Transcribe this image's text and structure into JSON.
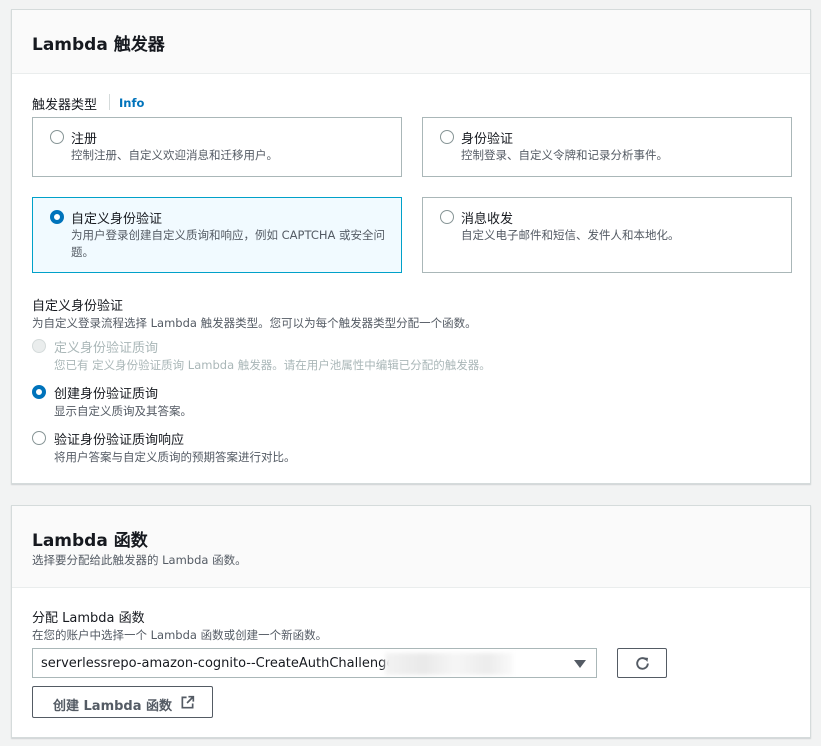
{
  "trigger_panel": {
    "title": "Lambda 触发器",
    "trigger_type_label": "触发器类型",
    "info_link": "Info",
    "tiles": [
      {
        "title": "注册",
        "desc": "控制注册、自定义欢迎消息和迁移用户。",
        "selected": false
      },
      {
        "title": "身份验证",
        "desc": "控制登录、自定义令牌和记录分析事件。",
        "selected": false
      },
      {
        "title": "自定义身份验证",
        "desc": "为用户登录创建自定义质询和响应，例如 CAPTCHA 或安全问题。",
        "selected": true
      },
      {
        "title": "消息收发",
        "desc": "自定义电子邮件和短信、发件人和本地化。",
        "selected": false
      }
    ],
    "custom_auth": {
      "label": "自定义身份验证",
      "desc": "为自定义登录流程选择 Lambda 触发器类型。您可以为每个触发器类型分配一个函数。",
      "options": [
        {
          "title": "定义身份验证质询",
          "desc": "您已有 定义身份验证质询 Lambda 触发器。请在用户池属性中编辑已分配的触发器。",
          "state": "disabled"
        },
        {
          "title": "创建身份验证质询",
          "desc": "显示自定义质询及其答案。",
          "state": "checked"
        },
        {
          "title": "验证身份验证质询响应",
          "desc": "将用户答案与自定义质询的预期答案进行对比。",
          "state": "unchecked"
        }
      ]
    }
  },
  "function_panel": {
    "title": "Lambda 函数",
    "desc": "选择要分配给此触发器的 Lambda 函数。",
    "assign_label": "分配 Lambda 函数",
    "assign_desc": "在您的账户中选择一个 Lambda 函数或创建一个新函数。",
    "selected_function": "serverlessrepo-amazon-cognito--CreateAuthChallenge",
    "create_button": "创建 Lambda 函数"
  },
  "colors": {
    "accent": "#0073bb",
    "selected_border": "#00a1c9",
    "selected_bg": "#f1faff"
  }
}
